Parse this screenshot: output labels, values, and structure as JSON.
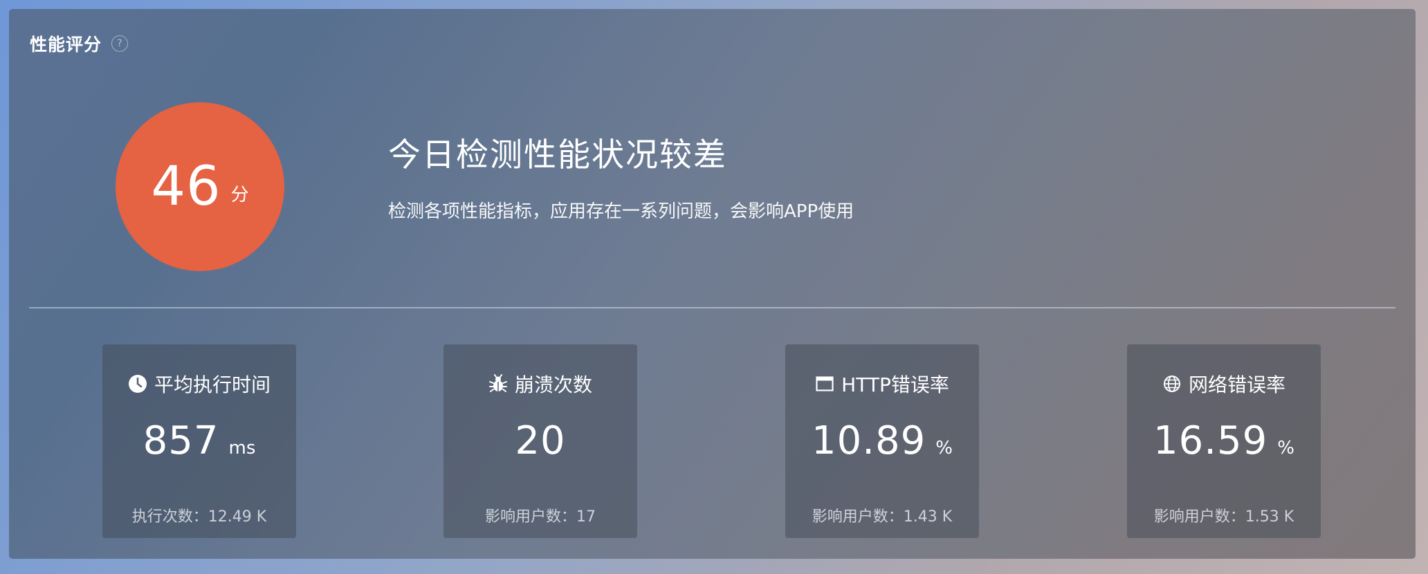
{
  "header": {
    "title": "性能评分",
    "help_icon": "?"
  },
  "score": {
    "value": "46",
    "unit": "分",
    "color": "#e56242"
  },
  "status": {
    "title": "今日检测性能状况较差",
    "description": "检测各项性能指标，应用存在一系列问题，会影响APP使用"
  },
  "cards": [
    {
      "icon": "clock-icon",
      "label": "平均执行时间",
      "value": "857",
      "unit": "ms",
      "footer": "执行次数：12.49 K"
    },
    {
      "icon": "bug-icon",
      "label": "崩溃次数",
      "value": "20",
      "unit": "",
      "footer": "影响用户数：17"
    },
    {
      "icon": "browser-window-icon",
      "label": "HTTP错误率",
      "value": "10.89",
      "unit": "%",
      "footer": "影响用户数：1.43 K"
    },
    {
      "icon": "globe-icon",
      "label": "网络错误率",
      "value": "16.59",
      "unit": "%",
      "footer": "影响用户数：1.53 K"
    }
  ]
}
